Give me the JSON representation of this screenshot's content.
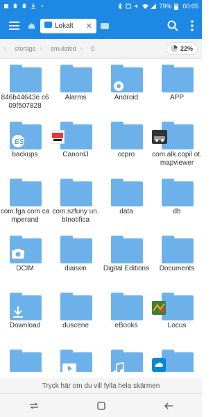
{
  "status_bar": {
    "battery": "79%",
    "time": "00:05"
  },
  "app_bar": {
    "tab_label": "Lokalt"
  },
  "breadcrumb": {
    "items": [
      "storage",
      "emulated",
      "0"
    ],
    "usage": "22%"
  },
  "folders": [
    {
      "name": "846b44643e c609f507828"
    },
    {
      "name": "Alarms"
    },
    {
      "name": "Android",
      "badge": "gear-icon"
    },
    {
      "name": "APP"
    },
    {
      "name": "backups",
      "badge": "es-logo-icon"
    },
    {
      "name": "CanonIJ",
      "badge": "canon-app-icon"
    },
    {
      "name": "ccpro"
    },
    {
      "name": "com.alk.copil ot.mapviewer",
      "badge": "copilot-app-icon"
    },
    {
      "name": "com.fga.com camperand"
    },
    {
      "name": "com.szfuny un.btnotifica"
    },
    {
      "name": "data"
    },
    {
      "name": "db"
    },
    {
      "name": "DCIM",
      "badge": "camera-icon"
    },
    {
      "name": "dianxin"
    },
    {
      "name": "Digital Editions"
    },
    {
      "name": "Documents"
    },
    {
      "name": "Download",
      "badge": "download-icon"
    },
    {
      "name": "duscene"
    },
    {
      "name": "eBooks"
    },
    {
      "name": "Locus",
      "badge": "locus-app-icon"
    },
    {
      "name": "",
      "badge": ""
    },
    {
      "name": "",
      "badge": "video-icon"
    },
    {
      "name": "",
      "badge": "music-icon"
    },
    {
      "name": "",
      "badge": "cloud-app-icon"
    }
  ],
  "fullscreen_hint": "Tryck här om du vill fylla hela skärmen",
  "colors": {
    "accent": "#1e88e5",
    "folder": "#6db1ea"
  }
}
